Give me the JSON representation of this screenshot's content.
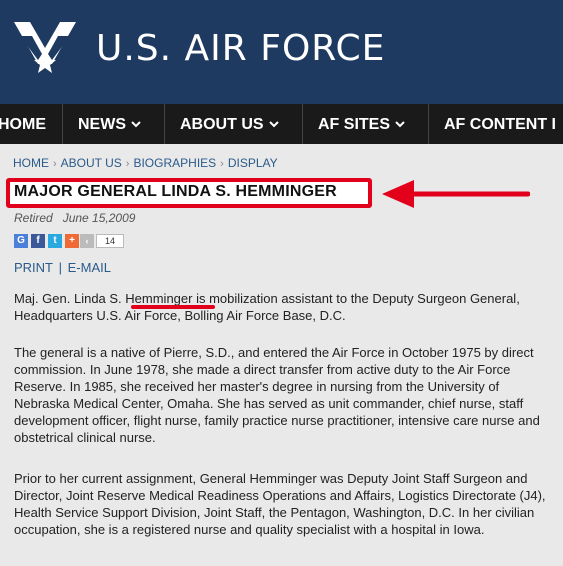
{
  "header": {
    "brand": "U.S. AIR FORCE",
    "logo_icon": "air-force-wings-icon"
  },
  "nav": {
    "items": [
      {
        "label": "HOME",
        "has_dropdown": false
      },
      {
        "label": "NEWS",
        "has_dropdown": true
      },
      {
        "label": "ABOUT US",
        "has_dropdown": true
      },
      {
        "label": "AF SITES",
        "has_dropdown": true
      },
      {
        "label": "AF CONTENT I",
        "has_dropdown": false
      }
    ]
  },
  "breadcrumb": [
    "HOME",
    "ABOUT US",
    "BIOGRAPHIES",
    "DISPLAY"
  ],
  "page": {
    "title": "MAJOR GENERAL LINDA S. HEMMINGER",
    "status": "Retired",
    "date": "June 15,2009"
  },
  "social": {
    "share_count": "14",
    "icons": [
      "google-icon",
      "facebook-icon",
      "twitter-icon",
      "plus-share-icon"
    ]
  },
  "actions": {
    "print": "PRINT",
    "email": "E-MAIL"
  },
  "body": {
    "p1": "Maj. Gen. Linda S. Hemminger is mobilization assistant to the Deputy Surgeon General, Headquarters U.S. Air Force, Bolling Air Force Base, D.C.",
    "p2": "The general is a native of Pierre, S.D., and entered the Air Force in October 1975 by direct commission. In June 1978, she made a direct transfer from active duty to the Air Force Reserve. In 1985, she received her master's degree in nursing from the University of Nebraska Medical Center, Omaha. She has served as unit commander, chief nurse, staff development officer, flight nurse, family practice nurse practitioner, intensive care nurse and obstetrical clinical nurse.",
    "p3": "Prior to her current assignment, General Hemminger was Deputy Joint Staff Surgeon and Director, Joint Reserve Medical Readiness Operations and Affairs, Logistics Directorate (J4), Health Service Support Division, Joint Staff, the Pentagon, Washington, D.C. In her civilian occupation, she is a registered nurse and quality specialist with a hospital in Iowa."
  },
  "colors": {
    "header_bg": "#1f3a61",
    "nav_bg": "#1a1a1a",
    "accent_red": "#e2001a",
    "link": "#2a5a8a"
  }
}
